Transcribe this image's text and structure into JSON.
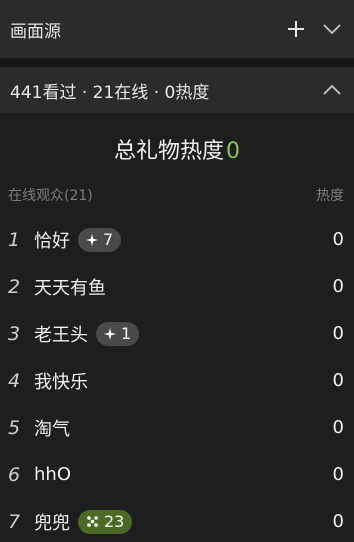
{
  "source_panel": {
    "title": "画面源",
    "add_icon": "plus-icon",
    "collapse_icon": "chevron-down-icon"
  },
  "stats_panel": {
    "summary": "441看过 · 21在线 · 0热度",
    "collapse_icon": "chevron-up-icon"
  },
  "gift_heat": {
    "label": "总礼物热度",
    "value": "0"
  },
  "viewers": {
    "header_left": "在线观众(21)",
    "header_right": "热度",
    "items": [
      {
        "rank": "1",
        "name": "恰好",
        "badge": "7",
        "badge_style": "gray",
        "badge_icon": "sparkle-icon",
        "heat": "0"
      },
      {
        "rank": "2",
        "name": "天天有鱼",
        "badge": "",
        "heat": "0"
      },
      {
        "rank": "3",
        "name": "老王头",
        "badge": "1",
        "badge_style": "gray",
        "badge_icon": "sparkle-icon",
        "heat": "0"
      },
      {
        "rank": "4",
        "name": "我快乐",
        "badge": "",
        "heat": "0"
      },
      {
        "rank": "5",
        "name": "淘气",
        "badge": "",
        "heat": "0"
      },
      {
        "rank": "6",
        "name": "hhO",
        "badge": "",
        "heat": "0"
      },
      {
        "rank": "7",
        "name": "兜兜",
        "badge": "23",
        "badge_style": "green",
        "badge_icon": "star-cluster-icon",
        "heat": "0"
      }
    ]
  },
  "colors": {
    "accent_green": "#8bc34a",
    "panel_bg": "#2b2b2d",
    "body_bg": "#1e1e20",
    "badge_gray": "#4a4a4c",
    "badge_green": "#4c6a25"
  }
}
